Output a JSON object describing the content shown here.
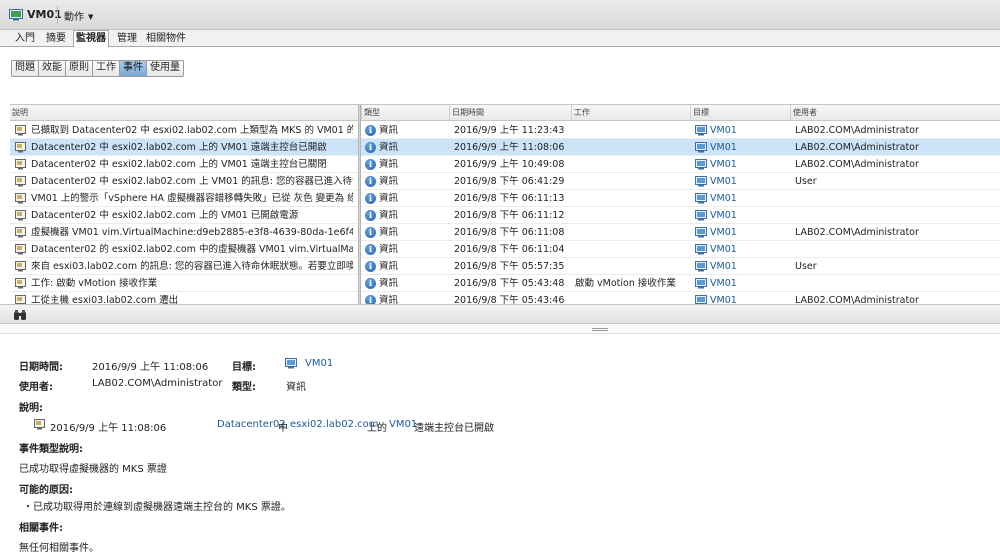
{
  "header": {
    "vm_name": "VM01",
    "actions_label": "動作"
  },
  "tabs": [
    "入門",
    "摘要",
    "監視器",
    "管理",
    "相關物件"
  ],
  "active_tab": 2,
  "subtabs": [
    "問題",
    "效能",
    "原則",
    "工作",
    "事件",
    "使用量"
  ],
  "active_subtab": 4,
  "grid": {
    "columns": [
      "說明",
      "類型",
      "日期時間",
      "工作",
      "目標",
      "使用者"
    ],
    "rows": [
      {
        "description": "已擷取到 Datacenter02 中 esxi02.lab02.com 上類型為 MKS 的 VM01 的票證",
        "type": "資訊",
        "datetime": "2016/9/9 上午 11:23:43",
        "task": "",
        "target": "VM01",
        "user": "LAB02.COM\\Administrator"
      },
      {
        "description": "Datacenter02 中 esxi02.lab02.com 上的 VM01 遠端主控台已開啟",
        "type": "資訊",
        "datetime": "2016/9/9 上午 11:08:06",
        "task": "",
        "target": "VM01",
        "user": "LAB02.COM\\Administrator"
      },
      {
        "description": "Datacenter02 中 esxi02.lab02.com 上的 VM01 遠端主控台已關閉",
        "type": "資訊",
        "datetime": "2016/9/9 上午 10:49:08",
        "task": "",
        "target": "VM01",
        "user": "LAB02.COM\\Administrator"
      },
      {
        "description": "Datacenter02 中 esxi02.lab02.com 上 VM01 的訊息: 您的容器已進入待命休眠...",
        "type": "資訊",
        "datetime": "2016/9/8 下午 06:41:29",
        "task": "",
        "target": "VM01",
        "user": "User"
      },
      {
        "description": "VM01 上的警示「vSphere HA 虛擬機器容錯移轉失敗」已從 灰色 變更為 綠色",
        "type": "資訊",
        "datetime": "2016/9/8 下午 06:11:13",
        "task": "",
        "target": "VM01",
        "user": ""
      },
      {
        "description": "Datacenter02 中 esxi02.lab02.com 上的 VM01 已開啟電源",
        "type": "資訊",
        "datetime": "2016/9/8 下午 06:11:12",
        "task": "",
        "target": "VM01",
        "user": ""
      },
      {
        "description": "虛擬機器 VM01 vim.VirtualMachine:d9eb2885-e3f8-4639-80da-1e6f457ba2e...",
        "type": "資訊",
        "datetime": "2016/9/8 下午 06:11:08",
        "task": "",
        "target": "VM01",
        "user": "LAB02.COM\\Administrator"
      },
      {
        "description": "Datacenter02 的 esxi02.lab02.com 中的虛擬機器 VM01 vim.VirtualMachine:e0...",
        "type": "資訊",
        "datetime": "2016/9/8 下午 06:11:04",
        "task": "",
        "target": "VM01",
        "user": ""
      },
      {
        "description": "來自 esxi03.lab02.com 的訊息: 您的容器已進入待命休眠狀態。若要立即喚醒...",
        "type": "資訊",
        "datetime": "2016/9/8 下午 05:57:35",
        "task": "",
        "target": "VM01",
        "user": "User"
      },
      {
        "description": "工作: 啟動 vMotion 接收作業",
        "type": "資訊",
        "datetime": "2016/9/8 下午 05:43:48",
        "task": "啟動 vMotion 接收作業",
        "target": "VM01",
        "user": ""
      },
      {
        "description": "工從主機 esxi03.lab02.com 遷出",
        "type": "資訊",
        "datetime": "2016/9/8 下午 05:43:46",
        "task": "",
        "target": "VM01",
        "user": "LAB02.COM\\Administrator"
      }
    ],
    "selected_row": 1
  },
  "details": {
    "datetime_label": "日期時間:",
    "datetime_value": "2016/9/9 上午 11:08:06",
    "target_label": "目標:",
    "target_value": "VM01",
    "user_label": "使用者:",
    "user_value": "LAB02.COM\\Administrator",
    "type_label": "類型:",
    "type_value": "資訊",
    "description_label": "說明:",
    "desc_datetime": "2016/9/9 上午 11:08:06",
    "desc_datacenter": "Datacenter02",
    "desc_in": "中",
    "desc_host": "esxi02.lab02.com",
    "desc_on": "上的",
    "desc_vm": "VM01",
    "desc_tail": "遠端主控台已開啟",
    "event_type_label": "事件類型說明:",
    "event_type_value": "已成功取得虛擬機器的 MKS 票證",
    "cause_label": "可能的原因:",
    "cause_value": "・已成功取得用於連線到虛擬機器遠端主控台的 MKS 票證。",
    "related_label": "相關事件:",
    "related_value": "無任何相關事件。"
  },
  "colors": {
    "selected_row": "#cde3f7",
    "link": "#1a5a9a",
    "subtab_active": "#7aa9d8"
  }
}
